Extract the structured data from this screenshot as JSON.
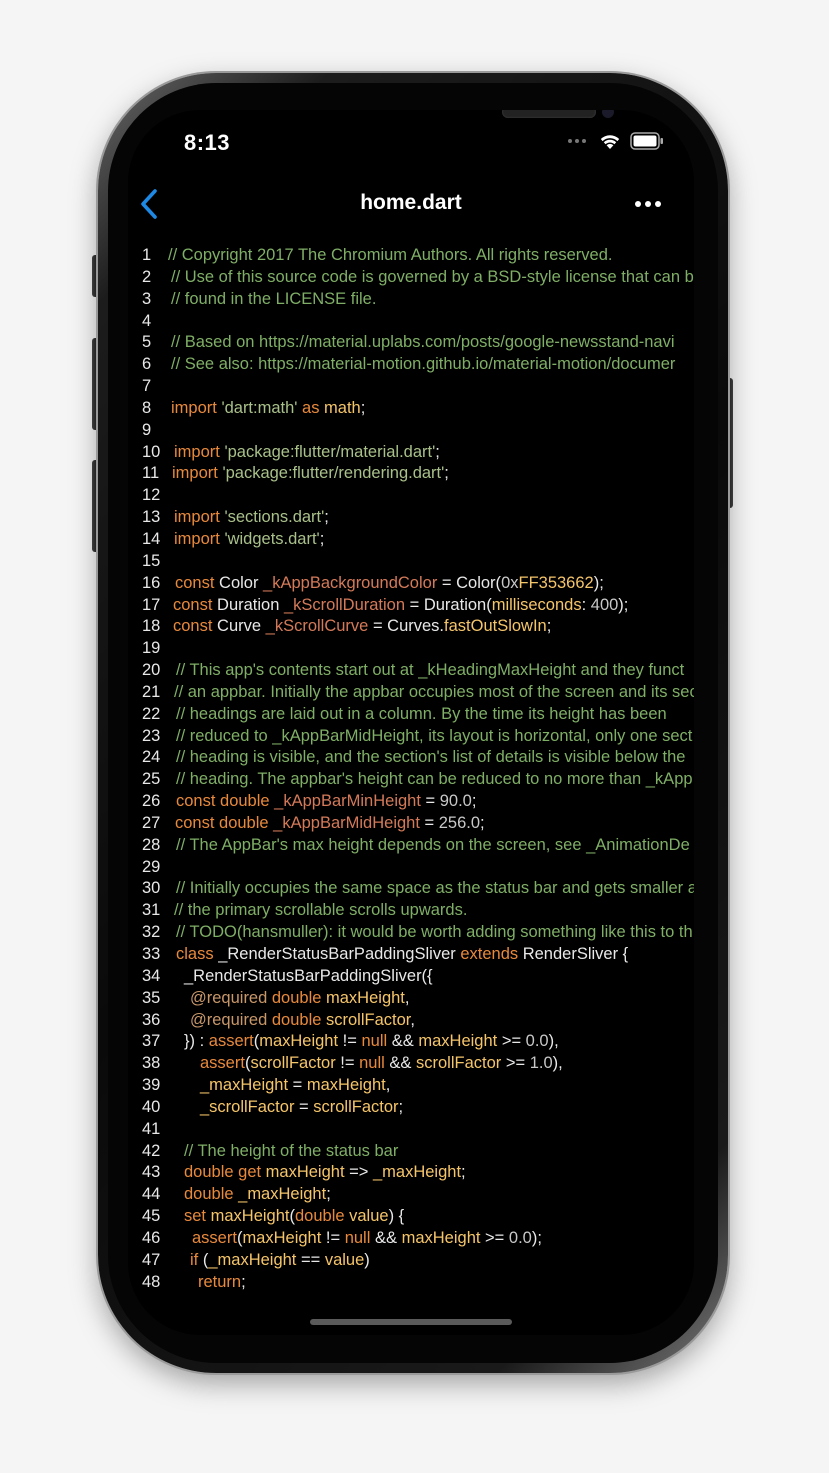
{
  "status_bar": {
    "time": "8:13"
  },
  "nav": {
    "title": "home.dart",
    "back_icon": "chevron-left-icon",
    "more_icon": "ellipsis-icon"
  },
  "colors": {
    "comment": "#7fae66",
    "keyword": "#e8893c",
    "accent_back": "#1e88e5",
    "background": "#000000"
  },
  "code": {
    "lines": [
      {
        "n": "1",
        "indent": 0,
        "tokens": [
          {
            "t": "// Copyright 2017 The Chromium Authors. All rights reserved.",
            "c": "comment"
          }
        ]
      },
      {
        "n": "2",
        "indent": 3,
        "tokens": [
          {
            "t": "// Use of this source code is governed by a BSD-style license that can b",
            "c": "comment"
          }
        ]
      },
      {
        "n": "3",
        "indent": 3,
        "tokens": [
          {
            "t": "// found in the LICENSE file.",
            "c": "comment"
          }
        ]
      },
      {
        "n": "4",
        "indent": 0,
        "tokens": []
      },
      {
        "n": "5",
        "indent": 3,
        "tokens": [
          {
            "t": "// Based on https://material.uplabs.com/posts/google-newsstand-navi",
            "c": "comment"
          }
        ]
      },
      {
        "n": "6",
        "indent": 3,
        "tokens": [
          {
            "t": "// See also: https://material-motion.github.io/material-motion/documer",
            "c": "comment"
          }
        ]
      },
      {
        "n": "7",
        "indent": 0,
        "tokens": []
      },
      {
        "n": "8",
        "indent": 3,
        "tokens": [
          {
            "t": "import ",
            "c": "kw"
          },
          {
            "t": "'dart:math' ",
            "c": "str"
          },
          {
            "t": "as ",
            "c": "kw"
          },
          {
            "t": "math",
            "c": "fn"
          },
          {
            "t": ";",
            "c": "plain"
          }
        ]
      },
      {
        "n": "9",
        "indent": 0,
        "tokens": []
      },
      {
        "n": "10",
        "indent": 6,
        "tokens": [
          {
            "t": "import ",
            "c": "kw"
          },
          {
            "t": "'package:flutter/material.dart'",
            "c": "str"
          },
          {
            "t": ";",
            "c": "plain"
          }
        ]
      },
      {
        "n": "11",
        "indent": 4,
        "tokens": [
          {
            "t": "import ",
            "c": "kw"
          },
          {
            "t": "'package:flutter/rendering.dart'",
            "c": "str"
          },
          {
            "t": ";",
            "c": "plain"
          }
        ]
      },
      {
        "n": "12",
        "indent": 0,
        "tokens": []
      },
      {
        "n": "13",
        "indent": 6,
        "tokens": [
          {
            "t": "import ",
            "c": "kw"
          },
          {
            "t": "'sections.dart'",
            "c": "str"
          },
          {
            "t": ";",
            "c": "plain"
          }
        ]
      },
      {
        "n": "14",
        "indent": 6,
        "tokens": [
          {
            "t": "import ",
            "c": "kw"
          },
          {
            "t": "'widgets.dart'",
            "c": "str"
          },
          {
            "t": ";",
            "c": "plain"
          }
        ]
      },
      {
        "n": "15",
        "indent": 0,
        "tokens": []
      },
      {
        "n": "16",
        "indent": 7,
        "tokens": [
          {
            "t": "const ",
            "c": "kw"
          },
          {
            "t": "Color ",
            "c": "type"
          },
          {
            "t": "_kAppBackgroundColor ",
            "c": "field"
          },
          {
            "t": "= Color(",
            "c": "plain"
          },
          {
            "t": "0x",
            "c": "num"
          },
          {
            "t": "FF353662",
            "c": "fn"
          },
          {
            "t": ");",
            "c": "plain"
          }
        ]
      },
      {
        "n": "17",
        "indent": 5,
        "tokens": [
          {
            "t": "const ",
            "c": "kw"
          },
          {
            "t": "Duration ",
            "c": "type"
          },
          {
            "t": "_kScrollDuration ",
            "c": "field"
          },
          {
            "t": "= Duration(",
            "c": "plain"
          },
          {
            "t": "milliseconds",
            "c": "fn"
          },
          {
            "t": ": ",
            "c": "plain"
          },
          {
            "t": "400",
            "c": "num"
          },
          {
            "t": ");",
            "c": "plain"
          }
        ]
      },
      {
        "n": "18",
        "indent": 5,
        "tokens": [
          {
            "t": "const ",
            "c": "kw"
          },
          {
            "t": "Curve ",
            "c": "type"
          },
          {
            "t": "_kScrollCurve ",
            "c": "field"
          },
          {
            "t": "= Curves.",
            "c": "plain"
          },
          {
            "t": "fastOutSlowIn",
            "c": "fn"
          },
          {
            "t": ";",
            "c": "plain"
          }
        ]
      },
      {
        "n": "19",
        "indent": 0,
        "tokens": []
      },
      {
        "n": "20",
        "indent": 8,
        "tokens": [
          {
            "t": "// This app's contents start out at _kHeadingMaxHeight and they funct",
            "c": "comment"
          }
        ]
      },
      {
        "n": "21",
        "indent": 6,
        "tokens": [
          {
            "t": "// an appbar. Initially the appbar occupies most of the screen and its sec",
            "c": "comment"
          }
        ]
      },
      {
        "n": "22",
        "indent": 8,
        "tokens": [
          {
            "t": "// headings are laid out in a column. By the time its height has been",
            "c": "comment"
          }
        ]
      },
      {
        "n": "23",
        "indent": 8,
        "tokens": [
          {
            "t": "// reduced to _kAppBarMidHeight, its layout is horizontal, only one sect",
            "c": "comment"
          }
        ]
      },
      {
        "n": "24",
        "indent": 8,
        "tokens": [
          {
            "t": "// heading is visible, and the section's list of details is visible below the",
            "c": "comment"
          }
        ]
      },
      {
        "n": "25",
        "indent": 8,
        "tokens": [
          {
            "t": "// heading. The appbar's height can be reduced to no more than _kApp",
            "c": "comment"
          }
        ]
      },
      {
        "n": "26",
        "indent": 8,
        "tokens": [
          {
            "t": "const ",
            "c": "kw"
          },
          {
            "t": "double ",
            "c": "kw"
          },
          {
            "t": "_kAppBarMinHeight ",
            "c": "field"
          },
          {
            "t": "= ",
            "c": "plain"
          },
          {
            "t": "90.0",
            "c": "num"
          },
          {
            "t": ";",
            "c": "plain"
          }
        ]
      },
      {
        "n": "27",
        "indent": 7,
        "tokens": [
          {
            "t": "const ",
            "c": "kw"
          },
          {
            "t": "double ",
            "c": "kw"
          },
          {
            "t": "_kAppBarMidHeight ",
            "c": "field"
          },
          {
            "t": "= ",
            "c": "plain"
          },
          {
            "t": "256.0",
            "c": "num"
          },
          {
            "t": ";",
            "c": "plain"
          }
        ]
      },
      {
        "n": "28",
        "indent": 8,
        "tokens": [
          {
            "t": "// The AppBar's max height depends on the screen, see _AnimationDe",
            "c": "comment"
          }
        ]
      },
      {
        "n": "29",
        "indent": 0,
        "tokens": []
      },
      {
        "n": "30",
        "indent": 8,
        "tokens": [
          {
            "t": "// Initially occupies the same space as the status bar and gets smaller a",
            "c": "comment"
          }
        ]
      },
      {
        "n": "31",
        "indent": 6,
        "tokens": [
          {
            "t": "// the primary scrollable scrolls upwards.",
            "c": "comment"
          }
        ]
      },
      {
        "n": "32",
        "indent": 8,
        "tokens": [
          {
            "t": "// TODO(hansmuller): it would be worth adding something like this to th",
            "c": "comment"
          }
        ]
      },
      {
        "n": "33",
        "indent": 8,
        "tokens": [
          {
            "t": "class ",
            "c": "kw"
          },
          {
            "t": "_RenderStatusBarPaddingSliver ",
            "c": "plain"
          },
          {
            "t": "extends ",
            "c": "kw"
          },
          {
            "t": "RenderSliver {",
            "c": "plain"
          }
        ]
      },
      {
        "n": "34",
        "indent": 16,
        "tokens": [
          {
            "t": "_RenderStatusBarPaddingSliver({",
            "c": "plain"
          }
        ]
      },
      {
        "n": "35",
        "indent": 22,
        "tokens": [
          {
            "t": "@required ",
            "c": "ann"
          },
          {
            "t": "double ",
            "c": "kw"
          },
          {
            "t": "maxHeight",
            "c": "fn"
          },
          {
            "t": ",",
            "c": "plain"
          }
        ]
      },
      {
        "n": "36",
        "indent": 22,
        "tokens": [
          {
            "t": "@required ",
            "c": "ann"
          },
          {
            "t": "double ",
            "c": "kw"
          },
          {
            "t": "scrollFactor",
            "c": "fn"
          },
          {
            "t": ",",
            "c": "plain"
          }
        ]
      },
      {
        "n": "37",
        "indent": 16,
        "tokens": [
          {
            "t": "}) : ",
            "c": "plain"
          },
          {
            "t": "assert",
            "c": "kw"
          },
          {
            "t": "(",
            "c": "plain"
          },
          {
            "t": "maxHeight ",
            "c": "fn"
          },
          {
            "t": "!= ",
            "c": "plain"
          },
          {
            "t": "null ",
            "c": "kw"
          },
          {
            "t": "&& ",
            "c": "plain"
          },
          {
            "t": "maxHeight ",
            "c": "fn"
          },
          {
            "t": ">= ",
            "c": "plain"
          },
          {
            "t": "0.0",
            "c": "num"
          },
          {
            "t": "),",
            "c": "plain"
          }
        ]
      },
      {
        "n": "38",
        "indent": 32,
        "tokens": [
          {
            "t": "assert",
            "c": "kw"
          },
          {
            "t": "(",
            "c": "plain"
          },
          {
            "t": "scrollFactor ",
            "c": "fn"
          },
          {
            "t": "!= ",
            "c": "plain"
          },
          {
            "t": "null ",
            "c": "kw"
          },
          {
            "t": "&& ",
            "c": "plain"
          },
          {
            "t": "scrollFactor ",
            "c": "fn"
          },
          {
            "t": ">= ",
            "c": "plain"
          },
          {
            "t": "1.0",
            "c": "num"
          },
          {
            "t": "),",
            "c": "plain"
          }
        ]
      },
      {
        "n": "39",
        "indent": 32,
        "tokens": [
          {
            "t": "_maxHeight ",
            "c": "fn"
          },
          {
            "t": "= ",
            "c": "plain"
          },
          {
            "t": "maxHeight",
            "c": "fn"
          },
          {
            "t": ",",
            "c": "plain"
          }
        ]
      },
      {
        "n": "40",
        "indent": 32,
        "tokens": [
          {
            "t": "_scrollFactor ",
            "c": "fn"
          },
          {
            "t": "= ",
            "c": "plain"
          },
          {
            "t": "scrollFactor",
            "c": "fn"
          },
          {
            "t": ";",
            "c": "plain"
          }
        ]
      },
      {
        "n": "41",
        "indent": 0,
        "tokens": []
      },
      {
        "n": "42",
        "indent": 16,
        "tokens": [
          {
            "t": "// The height of the status bar",
            "c": "comment"
          }
        ]
      },
      {
        "n": "43",
        "indent": 16,
        "tokens": [
          {
            "t": "double ",
            "c": "kw"
          },
          {
            "t": "get ",
            "c": "kw"
          },
          {
            "t": "maxHeight ",
            "c": "fn"
          },
          {
            "t": "=> ",
            "c": "plain"
          },
          {
            "t": "_maxHeight",
            "c": "fn"
          },
          {
            "t": ";",
            "c": "plain"
          }
        ]
      },
      {
        "n": "44",
        "indent": 16,
        "tokens": [
          {
            "t": "double ",
            "c": "kw"
          },
          {
            "t": "_maxHeight",
            "c": "fn"
          },
          {
            "t": ";",
            "c": "plain"
          }
        ]
      },
      {
        "n": "45",
        "indent": 16,
        "tokens": [
          {
            "t": "set ",
            "c": "kw"
          },
          {
            "t": "maxHeight",
            "c": "fn"
          },
          {
            "t": "(",
            "c": "plain"
          },
          {
            "t": "double ",
            "c": "kw"
          },
          {
            "t": "value",
            "c": "fn"
          },
          {
            "t": ") {",
            "c": "plain"
          }
        ]
      },
      {
        "n": "46",
        "indent": 24,
        "tokens": [
          {
            "t": "assert",
            "c": "kw"
          },
          {
            "t": "(",
            "c": "plain"
          },
          {
            "t": "maxHeight ",
            "c": "fn"
          },
          {
            "t": "!= ",
            "c": "plain"
          },
          {
            "t": "null ",
            "c": "kw"
          },
          {
            "t": "&& ",
            "c": "plain"
          },
          {
            "t": "maxHeight ",
            "c": "fn"
          },
          {
            "t": ">= ",
            "c": "plain"
          },
          {
            "t": "0.0",
            "c": "num"
          },
          {
            "t": ");",
            "c": "plain"
          }
        ]
      },
      {
        "n": "47",
        "indent": 22,
        "tokens": [
          {
            "t": "if ",
            "c": "kw"
          },
          {
            "t": "(",
            "c": "plain"
          },
          {
            "t": "_maxHeight ",
            "c": "fn"
          },
          {
            "t": "== ",
            "c": "plain"
          },
          {
            "t": "value",
            "c": "fn"
          },
          {
            "t": ")",
            "c": "plain"
          }
        ]
      },
      {
        "n": "48",
        "indent": 30,
        "tokens": [
          {
            "t": "return",
            "c": "kw"
          },
          {
            "t": ";",
            "c": "plain"
          }
        ]
      }
    ]
  }
}
